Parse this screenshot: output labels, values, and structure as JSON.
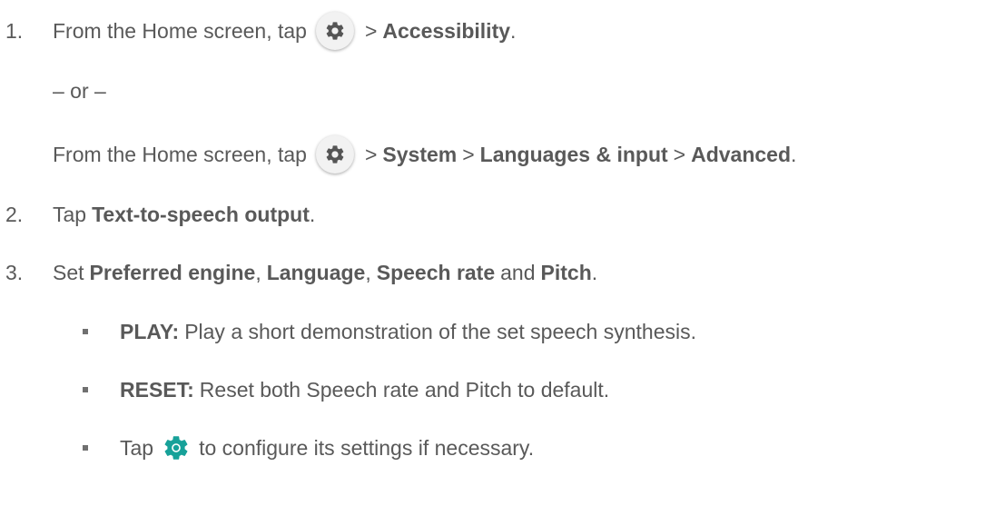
{
  "step1": {
    "number": "1.",
    "pre": "From the Home screen, tap",
    "sep1": ">",
    "accessibility": "Accessibility",
    "end": "."
  },
  "or_line": "– or –",
  "step1_alt": {
    "pre": "From the Home screen, tap",
    "sep1": ">",
    "system": "System",
    "sep2": ">",
    "languages": "Languages & input",
    "sep3": ">",
    "advanced": "Advanced",
    "end": "."
  },
  "step2": {
    "number": "2.",
    "pre": "Tap",
    "tts": "Text-to-speech output",
    "end": "."
  },
  "step3": {
    "number": "3.",
    "pre": "Set",
    "engine": "Preferred engine",
    "comma1": ",",
    "language": "Language",
    "comma2": ",",
    "rate": "Speech rate",
    "and": "and",
    "pitch": "Pitch",
    "end": "."
  },
  "bullets": {
    "play_label": "PLAY:",
    "play_text": "Play a short demonstration of the set speech synthesis.",
    "reset_label": "RESET:",
    "reset_text": "Reset both Speech rate and Pitch to default.",
    "tap_pre": "Tap",
    "tap_post": "to configure its settings if necessary."
  },
  "icons": {
    "settings_icon_color": "#555555",
    "config_icon_color": "#17a199"
  }
}
